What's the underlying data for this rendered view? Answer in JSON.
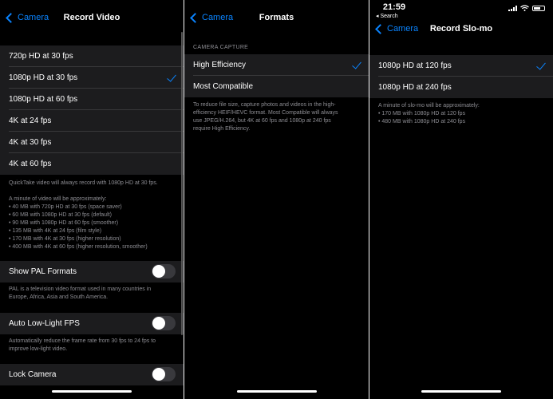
{
  "record_video": {
    "back_label": "Camera",
    "title": "Record Video",
    "options": [
      {
        "label": "720p HD at 30 fps",
        "selected": false
      },
      {
        "label": "1080p HD at 30 fps",
        "selected": true
      },
      {
        "label": "1080p HD at 60 fps",
        "selected": false
      },
      {
        "label": "4K at 24 fps",
        "selected": false
      },
      {
        "label": "4K at 30 fps",
        "selected": false
      },
      {
        "label": "4K at 60 fps",
        "selected": false
      }
    ],
    "quicktake_note": "QuickTake video will always record with 1080p HD at 30 fps.",
    "size_note_intro": "A minute of video will be approximately:",
    "size_note_lines": [
      "• 40 MB with 720p HD at 30 fps (space saver)",
      "• 60 MB with 1080p HD at 30 fps (default)",
      "• 90 MB with 1080p HD at 60 fps (smoother)",
      "• 135 MB with 4K at 24 fps (film style)",
      "• 170 MB with 4K at 30 fps (higher resolution)",
      "• 400 MB with 4K at 60 fps (higher resolution, smoother)"
    ],
    "pal_label": "Show PAL Formats",
    "pal_on": false,
    "pal_note_lines": [
      "PAL is a television video format used in many countries in",
      "Europe, Africa, Asia and South America."
    ],
    "low_light_label": "Auto Low-Light FPS",
    "low_light_on": false,
    "low_light_note_lines": [
      "Automatically reduce the frame rate from 30 fps to 24 fps to",
      "improve low-light video."
    ],
    "lock_camera_label": "Lock Camera",
    "lock_camera_on": false
  },
  "formats": {
    "back_label": "Camera",
    "title": "Formats",
    "section_header": "CAMERA CAPTURE",
    "options": [
      {
        "label": "High Efficiency",
        "selected": true
      },
      {
        "label": "Most Compatible",
        "selected": false
      }
    ],
    "note_lines": [
      "To reduce file size, capture photos and videos in the high-",
      "efficiency HEIF/HEVC format. Most Compatible will always",
      "use JPEG/H.264, but 4K at 60 fps and 1080p at 240 fps",
      "require High Efficiency."
    ]
  },
  "slomo": {
    "status_time": "21:59",
    "status_back_app": "◂ Search",
    "back_label": "Camera",
    "title": "Record Slo-mo",
    "options": [
      {
        "label": "1080p HD at 120 fps",
        "selected": true
      },
      {
        "label": "1080p HD at 240 fps",
        "selected": false
      }
    ],
    "note_intro": "A minute of slo-mo will be approximately:",
    "note_lines": [
      "• 170 MB with 1080p HD at 120 fps",
      "• 480 MB with 1080p HD at 240 fps"
    ]
  },
  "colors": {
    "accent": "#0a84ff",
    "background": "#000000",
    "cell": "#1c1c1e",
    "secondary_text": "#8d8d93"
  }
}
